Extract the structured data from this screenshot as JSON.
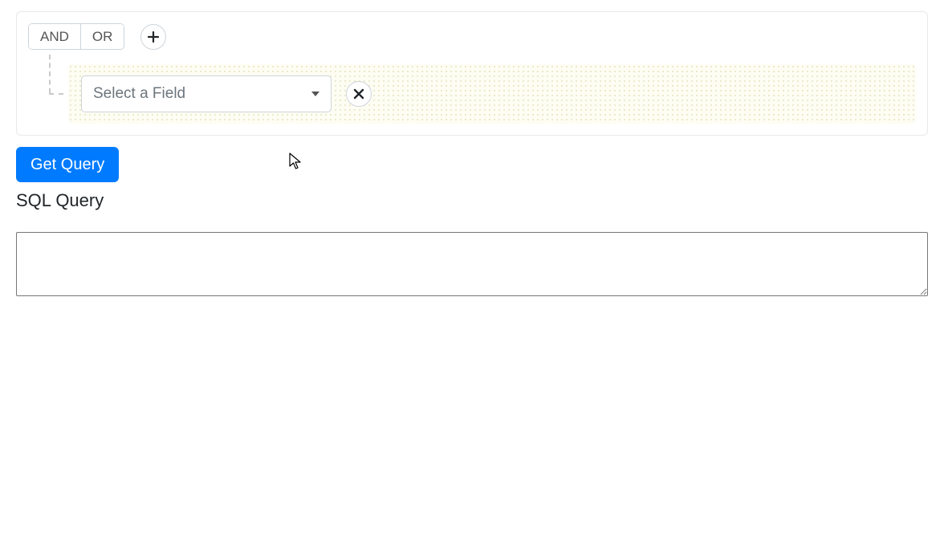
{
  "query_builder": {
    "logic": {
      "and_label": "AND",
      "or_label": "OR"
    },
    "rule": {
      "field_placeholder": "Select a Field"
    }
  },
  "actions": {
    "get_query_label": "Get Query"
  },
  "output": {
    "title": "SQL Query",
    "value": ""
  }
}
